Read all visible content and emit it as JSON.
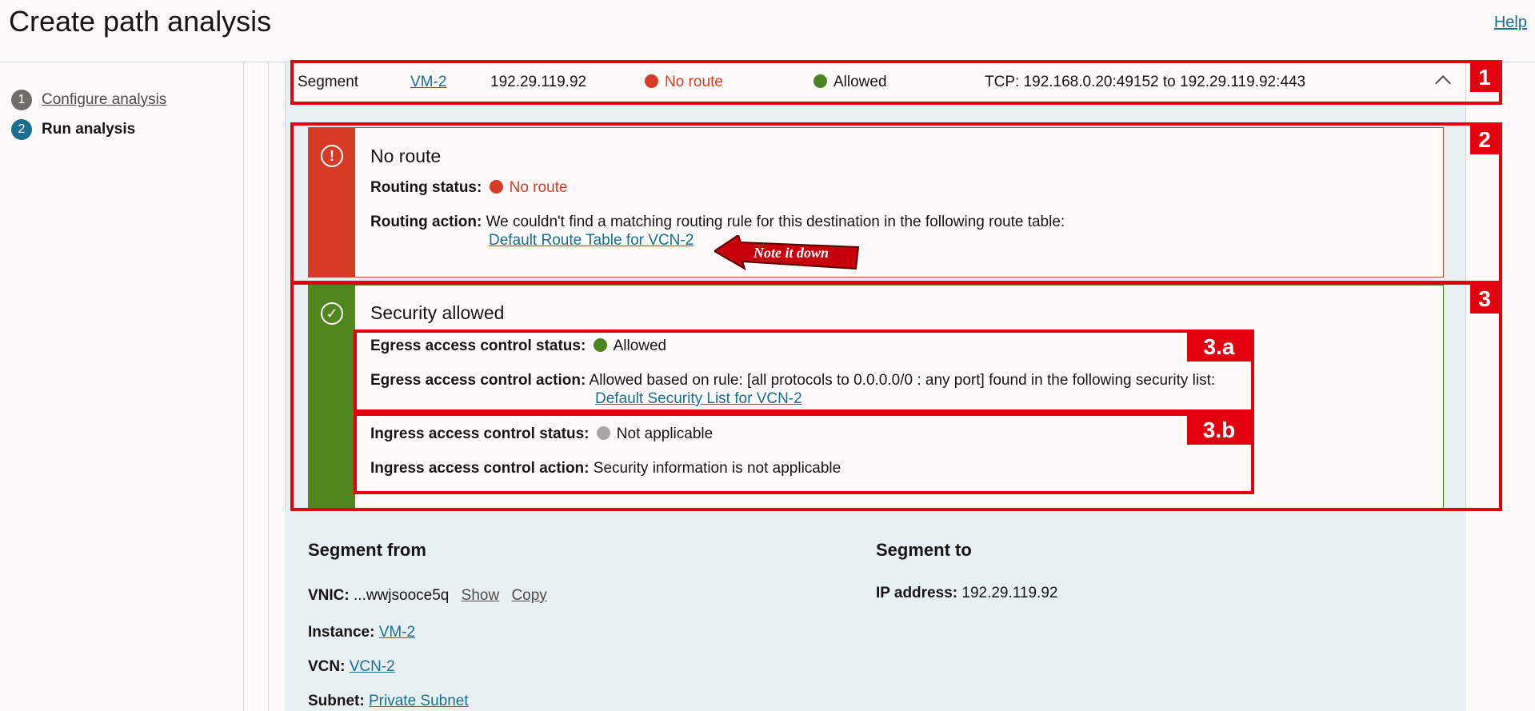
{
  "header": {
    "title": "Create path analysis",
    "help": "Help"
  },
  "steps": [
    {
      "num": "1",
      "label": "Configure analysis"
    },
    {
      "num": "2",
      "label": "Run analysis"
    }
  ],
  "segment_row": {
    "type": "Segment",
    "name": "VM-2",
    "ip": "192.29.119.92",
    "routing": "No route",
    "security": "Allowed",
    "protocol": "TCP: 192.168.0.20:49152 to 192.29.119.92:443"
  },
  "routing_card": {
    "title": "No route",
    "status_label": "Routing status:",
    "status_value": "No route",
    "action_label": "Routing action:",
    "action_text": "We couldn't find a matching routing rule for this destination in the following route table:",
    "action_link": "Default Route Table for VCN-2"
  },
  "security_card": {
    "title": "Security allowed",
    "egress_status_label": "Egress access control status:",
    "egress_status_value": "Allowed",
    "egress_action_label": "Egress access control action:",
    "egress_action_text": "Allowed based on rule: [all protocols to 0.0.0.0/0 : any port] found in the following security list:",
    "egress_action_link": "Default Security List for VCN-2",
    "ingress_status_label": "Ingress access control status:",
    "ingress_status_value": "Not applicable",
    "ingress_action_label": "Ingress access control action:",
    "ingress_action_text": "Security information is not applicable"
  },
  "details": {
    "from_heading": "Segment from",
    "vnic_label": "VNIC:",
    "vnic_value": "...wwjsooce5q",
    "show": "Show",
    "copy": "Copy",
    "instance_label": "Instance:",
    "instance_value": "VM-2",
    "vcn_label": "VCN:",
    "vcn_value": "VCN-2",
    "subnet_label": "Subnet:",
    "subnet_value": "Private Subnet",
    "to_heading": "Segment to",
    "ip_label": "IP address:",
    "ip_value": "192.29.119.92"
  },
  "annotations": {
    "tag1": "1",
    "tag2": "2",
    "tag3": "3",
    "tag3a": "3.a",
    "tag3b": "3.b",
    "note": "Note it down",
    "color": "#e3000f"
  }
}
